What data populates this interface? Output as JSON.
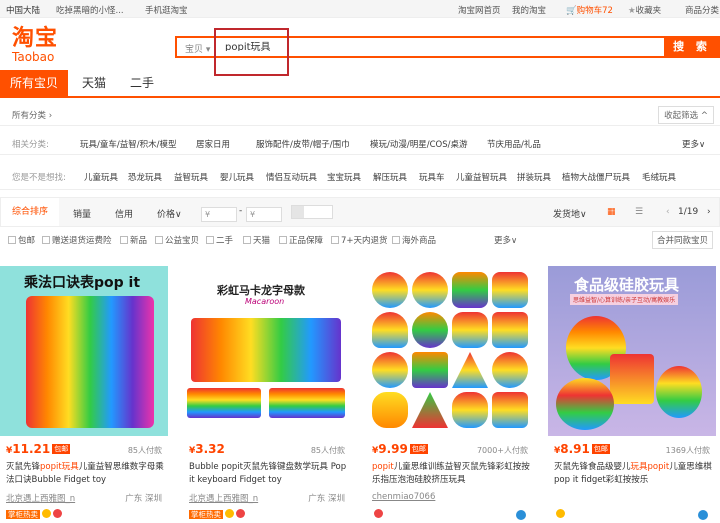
{
  "topbar": {
    "region": "中国大陆",
    "user": "吃掉黑暗的小怪...",
    "mobile": "手机逛淘宝",
    "home": "淘宝网首页",
    "my": "我的淘宝",
    "cart": "购物车",
    "cart_count": "72",
    "fav": "收藏夹",
    "category": "商品分类"
  },
  "logo": {
    "cn": "淘宝",
    "en": "Taobao"
  },
  "search": {
    "scope": "宝贝",
    "query": "popit玩具",
    "button": "搜 索"
  },
  "tabs": [
    "所有宝贝",
    "天猫",
    "二手"
  ],
  "breadcrumb": {
    "all": "所有分类 ›",
    "collapse": "收起筛选 ^"
  },
  "related": {
    "label": "相关分类:",
    "items": [
      "玩具/童车/益智/积木/模型",
      "居家日用",
      "服饰配件/皮带/帽子/围巾",
      "模玩/动漫/明星/COS/桌游",
      "节庆用品/礼品"
    ],
    "more": "更多∨"
  },
  "suggest": {
    "label": "您是不是想找:",
    "items": [
      "儿童玩具",
      "恐龙玩具",
      "益智玩具",
      "婴儿玩具",
      "情侣互动玩具",
      "宝宝玩具",
      "解压玩具",
      "玩具车",
      "儿童益智玩具",
      "拼装玩具",
      "植物大战僵尸玩具",
      "毛绒玩具"
    ]
  },
  "sort": {
    "items": [
      "综合排序",
      "销量",
      "信用",
      "价格∨"
    ],
    "min": "¥",
    "max": "¥",
    "dash": "-",
    "ship": "发货地∨",
    "page": "1/19",
    "prev": "‹",
    "next": "›"
  },
  "filters": {
    "items": [
      "包邮",
      "赠送退货运费险",
      "新品",
      "公益宝贝",
      "二手",
      "天猫",
      "正品保障",
      "7+天内退货",
      "海外商品"
    ],
    "more": "更多∨",
    "merge": "合并同款宝贝"
  },
  "products": [
    {
      "img_text": "乘法口诀表pop it",
      "price": "11.21",
      "badge": "包邮",
      "sold": "85人付款",
      "title_pre": "灭鼠先锋",
      "title_hl": "popit玩具",
      "title_post": "儿童益智思维数字母乘法口诀Bubble Fidget toy",
      "shop": "北京遇上西雅图_n",
      "loc": "广东 深圳",
      "hot": "掌柜热卖"
    },
    {
      "img_text": "彩虹马卡龙字母款",
      "img_sub": "Macaroon",
      "price": "3.32",
      "badge": "",
      "sold": "85人付款",
      "title_pre": "Bubble popit灭鼠先锋键盘数学玩具 Pop it keyboard Fidget toy",
      "title_hl": "",
      "title_post": "",
      "shop": "北京遇上西雅图_n",
      "loc": "广东 深圳",
      "hot": "掌柜热卖"
    },
    {
      "img_text": "",
      "price": "9.99",
      "badge": "包邮",
      "sold": "7000+人付款",
      "title_pre": "",
      "title_hl": "popit",
      "title_post": "儿童思维训练益智灭鼠先锋彩虹按按乐指压泡泡硅胶挤压玩具",
      "shop": "chenmiao7066",
      "loc": "",
      "hot": ""
    },
    {
      "img_text": "食品级硅胶玩具",
      "img_sub": "思维益智/心算训练/亲子互动/寓教娱乐",
      "price": "8.91",
      "badge": "包邮",
      "sold": "1369人付款",
      "title_pre": "灭鼠先锋食品级婴儿",
      "title_hl": "玩具popit",
      "title_post": "儿童思维棋pop it fidget彩虹按按乐",
      "shop": "",
      "loc": "",
      "hot": ""
    }
  ],
  "colors": {
    "accent": "#ff5000",
    "price": "#ff4400"
  }
}
